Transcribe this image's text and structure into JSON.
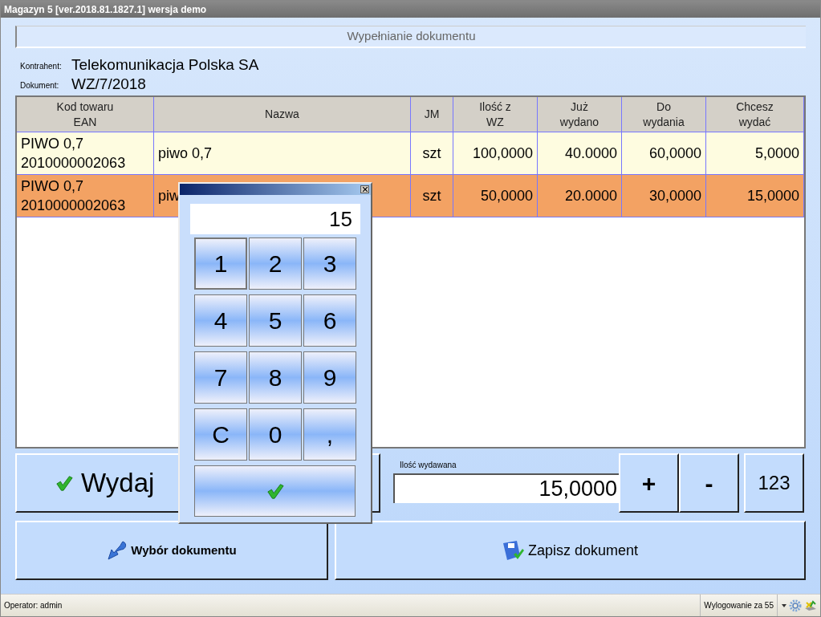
{
  "window": {
    "title": "Magazyn 5 [ver.2018.81.1827.1]  wersja demo"
  },
  "header": {
    "title": "Wypełnianie dokumentu"
  },
  "info": [
    {
      "label": "Kontrahent:",
      "value": "Telekomunikacja Polska SA"
    },
    {
      "label": "Dokument:",
      "value": "WZ/7/2018"
    }
  ],
  "table": {
    "columns": [
      "Kod towaru\nEAN",
      "Nazwa",
      "JM",
      "Ilość z\nWZ",
      "Już\nwydano",
      "Do\nwydania",
      "Chcesz\nwydać"
    ],
    "rows": [
      {
        "selected": false,
        "cells": [
          "PIWO 0,7\n2010000002063",
          "piwo 0,7",
          "szt",
          "100,0000",
          "40.0000",
          "60,0000",
          "5,0000"
        ]
      },
      {
        "selected": true,
        "cells": [
          "PIWO 0,7\n2010000002063",
          "piw",
          "szt",
          "50,0000",
          "20.0000",
          "30,0000",
          "15,0000"
        ]
      }
    ]
  },
  "issue_button": {
    "label": "Wydaj"
  },
  "quantity": {
    "label": "Ilość wydawana",
    "value": "15,0000"
  },
  "quantity_buttons": [
    "+",
    "-",
    "123"
  ],
  "bottom_buttons": [
    {
      "kind": "select",
      "label": "Wybór dokumentu"
    },
    {
      "kind": "save",
      "label": "Zapisz dokument"
    }
  ],
  "keypad": {
    "display": "15",
    "keys": [
      {
        "label": "1",
        "selected": true
      },
      {
        "label": "2",
        "selected": false
      },
      {
        "label": "3",
        "selected": false
      },
      {
        "label": "4",
        "selected": false
      },
      {
        "label": "5",
        "selected": false
      },
      {
        "label": "6",
        "selected": false
      },
      {
        "label": "7",
        "selected": false
      },
      {
        "label": "8",
        "selected": false
      },
      {
        "label": "9",
        "selected": false
      },
      {
        "label": "C",
        "selected": false
      },
      {
        "label": "0",
        "selected": false
      },
      {
        "label": ",",
        "selected": false
      }
    ]
  },
  "status_bar": {
    "operator": "Operator: admin",
    "logout": "Wylogowanie za 55"
  }
}
